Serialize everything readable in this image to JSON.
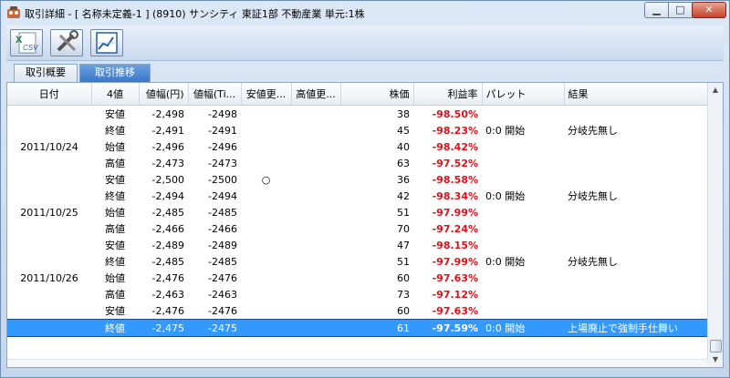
{
  "window": {
    "title": "取引詳細 - [ 名称未定義-1 ] (8910) サンシティ 東証1部 不動産業 単元:1株",
    "min_icon": "minimize-icon",
    "max_icon": "maximize-icon",
    "close_icon": "close-icon"
  },
  "toolbar": {
    "buttons": [
      {
        "name": "csv-export",
        "icon": "excel-csv-icon",
        "badge": "CSV"
      },
      {
        "name": "settings",
        "icon": "tools-icon"
      },
      {
        "name": "chart",
        "icon": "chart-icon"
      }
    ]
  },
  "tabs": [
    {
      "label": "取引概要",
      "active": false
    },
    {
      "label": "取引推移",
      "active": true
    }
  ],
  "table": {
    "columns": [
      "日付",
      "4値",
      "値幅(円)",
      "値幅(Ti...",
      "安値更...",
      "高値更...",
      "株価",
      "利益率",
      "パレット",
      "結果"
    ],
    "rows": [
      {
        "date": "",
        "kind": "安値",
        "yen": "-2,498",
        "ticks": "-2498",
        "low": "",
        "high": "",
        "price": "38",
        "rate": "-98.50%",
        "palette": "",
        "result": ""
      },
      {
        "date": "",
        "kind": "終値",
        "yen": "-2,491",
        "ticks": "-2491",
        "low": "",
        "high": "",
        "price": "45",
        "rate": "-98.23%",
        "palette": "0:0 開始",
        "result": "分岐先無し"
      },
      {
        "date": "2011/10/24",
        "kind": "始値",
        "yen": "-2,496",
        "ticks": "-2496",
        "low": "",
        "high": "",
        "price": "40",
        "rate": "-98.42%",
        "palette": "",
        "result": ""
      },
      {
        "date": "",
        "kind": "高値",
        "yen": "-2,473",
        "ticks": "-2473",
        "low": "",
        "high": "",
        "price": "63",
        "rate": "-97.52%",
        "palette": "",
        "result": ""
      },
      {
        "date": "",
        "kind": "安値",
        "yen": "-2,500",
        "ticks": "-2500",
        "low": "○",
        "high": "",
        "price": "36",
        "rate": "-98.58%",
        "palette": "",
        "result": ""
      },
      {
        "date": "",
        "kind": "終値",
        "yen": "-2,494",
        "ticks": "-2494",
        "low": "",
        "high": "",
        "price": "42",
        "rate": "-98.34%",
        "palette": "0:0 開始",
        "result": "分岐先無し"
      },
      {
        "date": "2011/10/25",
        "kind": "始値",
        "yen": "-2,485",
        "ticks": "-2485",
        "low": "",
        "high": "",
        "price": "51",
        "rate": "-97.99%",
        "palette": "",
        "result": ""
      },
      {
        "date": "",
        "kind": "高値",
        "yen": "-2,466",
        "ticks": "-2466",
        "low": "",
        "high": "",
        "price": "70",
        "rate": "-97.24%",
        "palette": "",
        "result": ""
      },
      {
        "date": "",
        "kind": "安値",
        "yen": "-2,489",
        "ticks": "-2489",
        "low": "",
        "high": "",
        "price": "47",
        "rate": "-98.15%",
        "palette": "",
        "result": ""
      },
      {
        "date": "",
        "kind": "終値",
        "yen": "-2,485",
        "ticks": "-2485",
        "low": "",
        "high": "",
        "price": "51",
        "rate": "-97.99%",
        "palette": "0:0 開始",
        "result": "分岐先無し"
      },
      {
        "date": "2011/10/26",
        "kind": "始値",
        "yen": "-2,476",
        "ticks": "-2476",
        "low": "",
        "high": "",
        "price": "60",
        "rate": "-97.63%",
        "palette": "",
        "result": ""
      },
      {
        "date": "",
        "kind": "高値",
        "yen": "-2,463",
        "ticks": "-2463",
        "low": "",
        "high": "",
        "price": "73",
        "rate": "-97.12%",
        "palette": "",
        "result": ""
      },
      {
        "date": "",
        "kind": "安値",
        "yen": "-2,476",
        "ticks": "-2476",
        "low": "",
        "high": "",
        "price": "60",
        "rate": "-97.63%",
        "palette": "",
        "result": ""
      },
      {
        "date": "",
        "kind": "終値",
        "yen": "-2,475",
        "ticks": "-2475",
        "low": "",
        "high": "",
        "price": "61",
        "rate": "-97.59%",
        "palette": "0:0 開始",
        "result": "上場廃止で強制手仕舞い",
        "selected": true
      }
    ]
  },
  "colors": {
    "negative_rate": "#e0101a",
    "selection": "#3399ff",
    "active_tab": "#3a78c8"
  }
}
